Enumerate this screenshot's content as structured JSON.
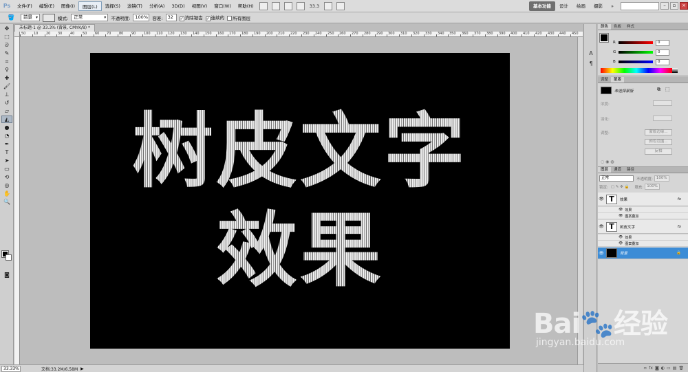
{
  "app": {
    "logo": "Ps"
  },
  "menu": [
    "文件(F)",
    "编辑(E)",
    "图像(I)",
    "图层(L)",
    "选择(S)",
    "滤镜(T)",
    "分析(A)",
    "3D(D)",
    "视图(V)",
    "窗口(W)",
    "帮助(H)"
  ],
  "menu_active_index": 3,
  "menubar": {
    "zoom": "33.3",
    "workspaces": [
      "基本功能",
      "设计",
      "绘画",
      "摄影"
    ],
    "more": "»"
  },
  "options": {
    "fill_source": "前景",
    "mode_label": "模式:",
    "mode_value": "正常",
    "opacity_label": "不透明度:",
    "opacity_value": "100%",
    "tolerance_label": "容差:",
    "tolerance_value": "32",
    "antialias_label": "消除锯齿",
    "contiguous_label": "连续的",
    "all_layers_label": "所有图层"
  },
  "document": {
    "tab_title": "未标题-1 @ 33.3% (背景, CMYK/8) *",
    "ruler_labels": [
      "50",
      "10",
      "20",
      "30",
      "40",
      "50",
      "60",
      "70",
      "80",
      "90",
      "100",
      "110",
      "120",
      "130",
      "140",
      "150",
      "160",
      "170",
      "180",
      "190",
      "200",
      "210",
      "220",
      "230",
      "240",
      "250",
      "260",
      "270",
      "280",
      "290",
      "300",
      "310",
      "320",
      "330",
      "340",
      "350",
      "360",
      "370",
      "380",
      "390",
      "400",
      "410",
      "420",
      "430",
      "440",
      "450"
    ],
    "art_line1": "树皮文字",
    "art_line2": "效果"
  },
  "status": {
    "zoom": "33.33%",
    "doc_info": "文档:33.2M/6.58M"
  },
  "panels": {
    "color": {
      "tabs": [
        "颜色",
        "色板",
        "样式"
      ],
      "channels": [
        {
          "label": "R",
          "value": "0",
          "gradient": [
            "#000000",
            "#ff0000"
          ]
        },
        {
          "label": "G",
          "value": "0",
          "gradient": [
            "#000000",
            "#00ff00"
          ]
        },
        {
          "label": "B",
          "value": "0",
          "gradient": [
            "#000000",
            "#0000ff"
          ]
        }
      ]
    },
    "masks": {
      "tabs": [
        "调整",
        "蒙版"
      ],
      "label": "未选择蒙版",
      "fields": [
        "浓度:",
        "羽化:",
        "调整:"
      ],
      "buttons": [
        "蒙版边缘...",
        "颜色范围...",
        "反相"
      ]
    },
    "layers": {
      "tabs": [
        "图层",
        "通道",
        "路径"
      ],
      "blend_mode": "正常",
      "opacity_label": "不透明度:",
      "opacity_value": "100%",
      "lock_label": "锁定:",
      "fill_label": "填充:",
      "fill_value": "100%",
      "items": [
        {
          "thumb": "T",
          "name": "效果",
          "fx": "fx",
          "effects_label": "效果",
          "effect": "图案叠加"
        },
        {
          "thumb": "T",
          "name": "树皮文字",
          "fx": "fx",
          "effects_label": "效果",
          "effect": "图案叠加"
        },
        {
          "thumb": "",
          "name": "背景",
          "lock": "🔒"
        }
      ],
      "bottom_icons": [
        "∞",
        "fx",
        "◙",
        "◐",
        "▭",
        "▤",
        "🗑"
      ]
    }
  },
  "watermark": {
    "brand": "Bai🐾经验",
    "url": "jingyan.baidu.com"
  }
}
